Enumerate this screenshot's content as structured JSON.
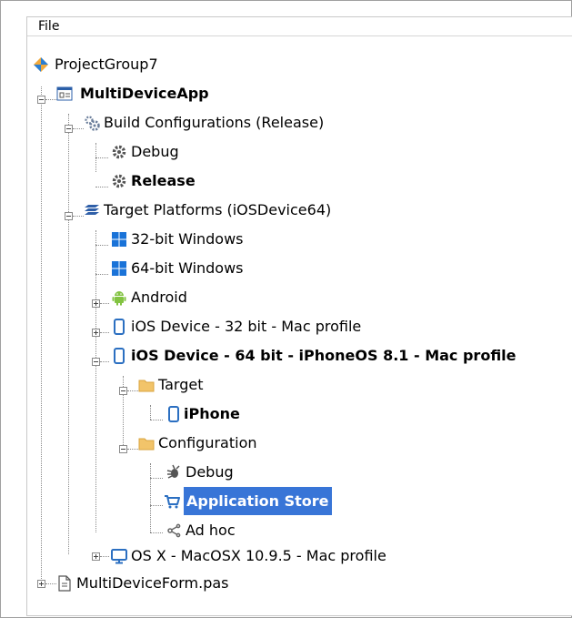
{
  "menu": {
    "file": "File"
  },
  "tree": {
    "project_group": "ProjectGroup7",
    "app": "MultiDeviceApp",
    "build_configurations": "Build Configurations (Release)",
    "debug": "Debug",
    "release": "Release",
    "target_platforms": "Target Platforms (iOSDevice64)",
    "win32": "32-bit Windows",
    "win64": "64-bit Windows",
    "android": "Android",
    "ios32": "iOS Device - 32 bit - Mac profile",
    "ios64": "iOS Device - 64 bit - iPhoneOS 8.1 - Mac profile",
    "target": "Target",
    "iphone": "iPhone",
    "configuration": "Configuration",
    "cfg_debug": "Debug",
    "app_store": "Application Store",
    "ad_hoc": "Ad hoc",
    "osx": "OS X - MacOSX 10.9.5 - Mac profile",
    "form": "MultiDeviceForm.pas"
  },
  "colors": {
    "selection": "#3875d7",
    "windows": "#1a73d8",
    "android": "#82c341",
    "ios": "#2b6fc1",
    "folder": "#f2c46a"
  }
}
